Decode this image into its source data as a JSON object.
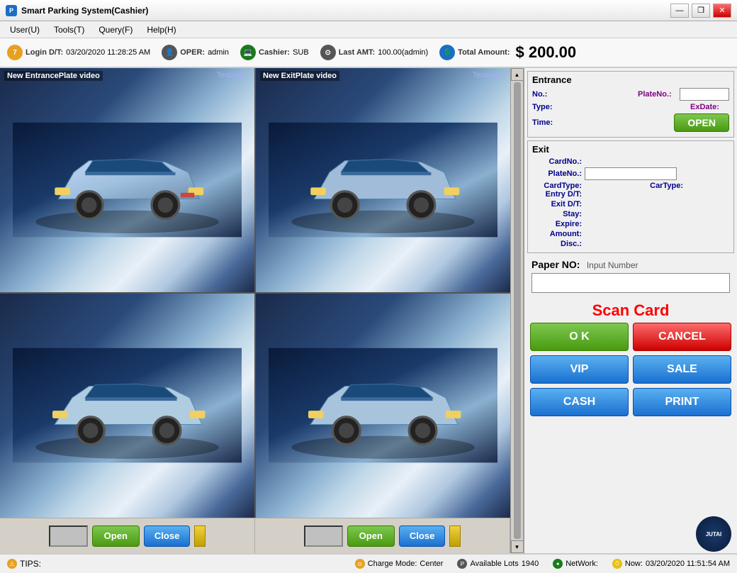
{
  "window": {
    "title": "Smart Parking System(Cashier)",
    "icon": "P"
  },
  "menu": {
    "items": [
      {
        "id": "user",
        "label": "User(U)"
      },
      {
        "id": "tools",
        "label": "Tools(T)"
      },
      {
        "id": "query",
        "label": "Query(F)"
      },
      {
        "id": "help",
        "label": "Help(H)"
      }
    ]
  },
  "status_top": {
    "login_label": "Login D/T:",
    "login_value": "03/20/2020 11:28:25 AM",
    "oper_label": "OPER:",
    "oper_value": "admin",
    "cashier_label": "Cashier:",
    "cashier_value": "SUB",
    "last_label": "Last AMT:",
    "last_value": "100.00(admin)",
    "total_label": "Total Amount:",
    "total_value": "$ 200.00"
  },
  "video": {
    "top_left": {
      "label": "New EntrancePlate video",
      "status": "Testing ..."
    },
    "top_right": {
      "label": "New ExitPlate video",
      "status": "Testing ..."
    },
    "bottom_left": {
      "label": "",
      "status": ""
    },
    "bottom_right": {
      "label": "",
      "status": ""
    }
  },
  "controls": {
    "entrance": {
      "open_label": "Open",
      "close_label": "Close"
    },
    "exit": {
      "open_label": "Open",
      "close_label": "Close"
    }
  },
  "entrance_panel": {
    "title": "Entrance",
    "no_label": "No.:",
    "plateno_label": "PlateNo.:",
    "type_label": "Type:",
    "exdate_label": "ExDate:",
    "time_label": "Time:",
    "open_button": "OPEN"
  },
  "exit_panel": {
    "title": "Exit",
    "cardno_label": "CardNo.:",
    "plateno_label": "PlateNo.:",
    "cardtype_label": "CardType:",
    "cartype_label": "CarType:",
    "entry_dt_label": "Entry D/T:",
    "exit_dt_label": "Exit D/T:",
    "stay_label": "Stay:",
    "expire_label": "Expire:",
    "amount_label": "Amount:",
    "disc_label": "Disc.:"
  },
  "paper": {
    "label": "Paper NO:",
    "hint": "Input Number"
  },
  "scan_card": {
    "label": "Scan Card"
  },
  "buttons": {
    "ok": "O K",
    "cancel": "CANCEL",
    "vip": "VIP",
    "sale": "SALE",
    "cash": "CASH",
    "print": "PRINT"
  },
  "status_bottom": {
    "charge_label": "Charge Mode:",
    "charge_value": "Center",
    "lots_label": "Available Lots",
    "lots_value": "1940",
    "network_label": "NetWork:",
    "network_value": "",
    "now_label": "Now:",
    "now_value": "03/20/2020 11:51:54 AM",
    "tips_label": "TIPS:",
    "jutai_label": "JUTAI"
  }
}
